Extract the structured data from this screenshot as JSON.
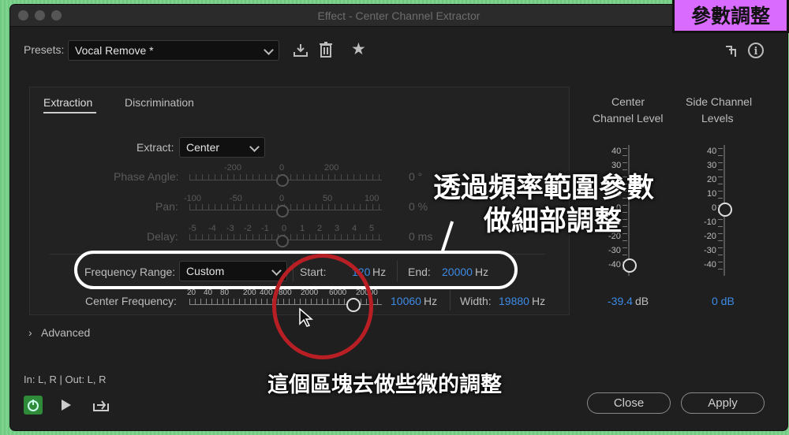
{
  "window": {
    "title": "Effect - Center Channel Extractor"
  },
  "badge": "參數調整",
  "presets": {
    "label": "Presets:",
    "value": "Vocal Remove *"
  },
  "icons": [
    "download-icon",
    "trash-icon",
    "star-icon",
    "routing-icon",
    "info-icon"
  ],
  "tabs": [
    {
      "label": "Extraction"
    },
    {
      "label": "Discrimination"
    }
  ],
  "extract": {
    "label": "Extract:",
    "value": "Center"
  },
  "phase": {
    "label": "Phase Angle:",
    "ticks": [
      "-200",
      "0",
      "200"
    ],
    "value": "0 °"
  },
  "pan": {
    "label": "Pan:",
    "ticks": [
      "-100",
      "-50",
      "0",
      "50",
      "100"
    ],
    "value": "0 %"
  },
  "delay": {
    "label": "Delay:",
    "ticks": [
      "-5",
      "-4",
      "-3",
      "-2",
      "-1",
      "0",
      "1",
      "2",
      "3",
      "4",
      "5"
    ],
    "value": "0 ms"
  },
  "frequency": {
    "label": "Frequency Range:",
    "value": "Custom",
    "start_label": "Start:",
    "start_value": "120",
    "start_unit": "Hz",
    "end_label": "End:",
    "end_value": "20000",
    "end_unit": "Hz"
  },
  "center_frequency": {
    "label": "Center Frequency:",
    "ticks": [
      "20",
      "40",
      "80",
      "200",
      "400",
      "800",
      "2000",
      "6000",
      "20000"
    ],
    "value": "10060",
    "unit": "Hz",
    "width_label": "Width:",
    "width_value": "19880",
    "width_unit": "Hz"
  },
  "levels": {
    "center_title_1": "Center",
    "center_title_2": "Channel Level",
    "side_title_1": "Side Channel",
    "side_title_2": "Levels",
    "scale_labels": [
      "40",
      "30",
      "20",
      "10",
      "0",
      "-10",
      "-20",
      "-30",
      "-40"
    ],
    "center_value": "-39.4",
    "center_unit": "dB",
    "side_value": "0 dB"
  },
  "advanced": {
    "label": "Advanced"
  },
  "io": "In: L, R | Out: L, R",
  "buttons": {
    "close": "Close",
    "apply": "Apply"
  },
  "overlay": {
    "callout_line1": "透過頻率範圍參數",
    "callout_line2": "做細部調整",
    "subtitle": "這個區塊去做些微的調整"
  }
}
